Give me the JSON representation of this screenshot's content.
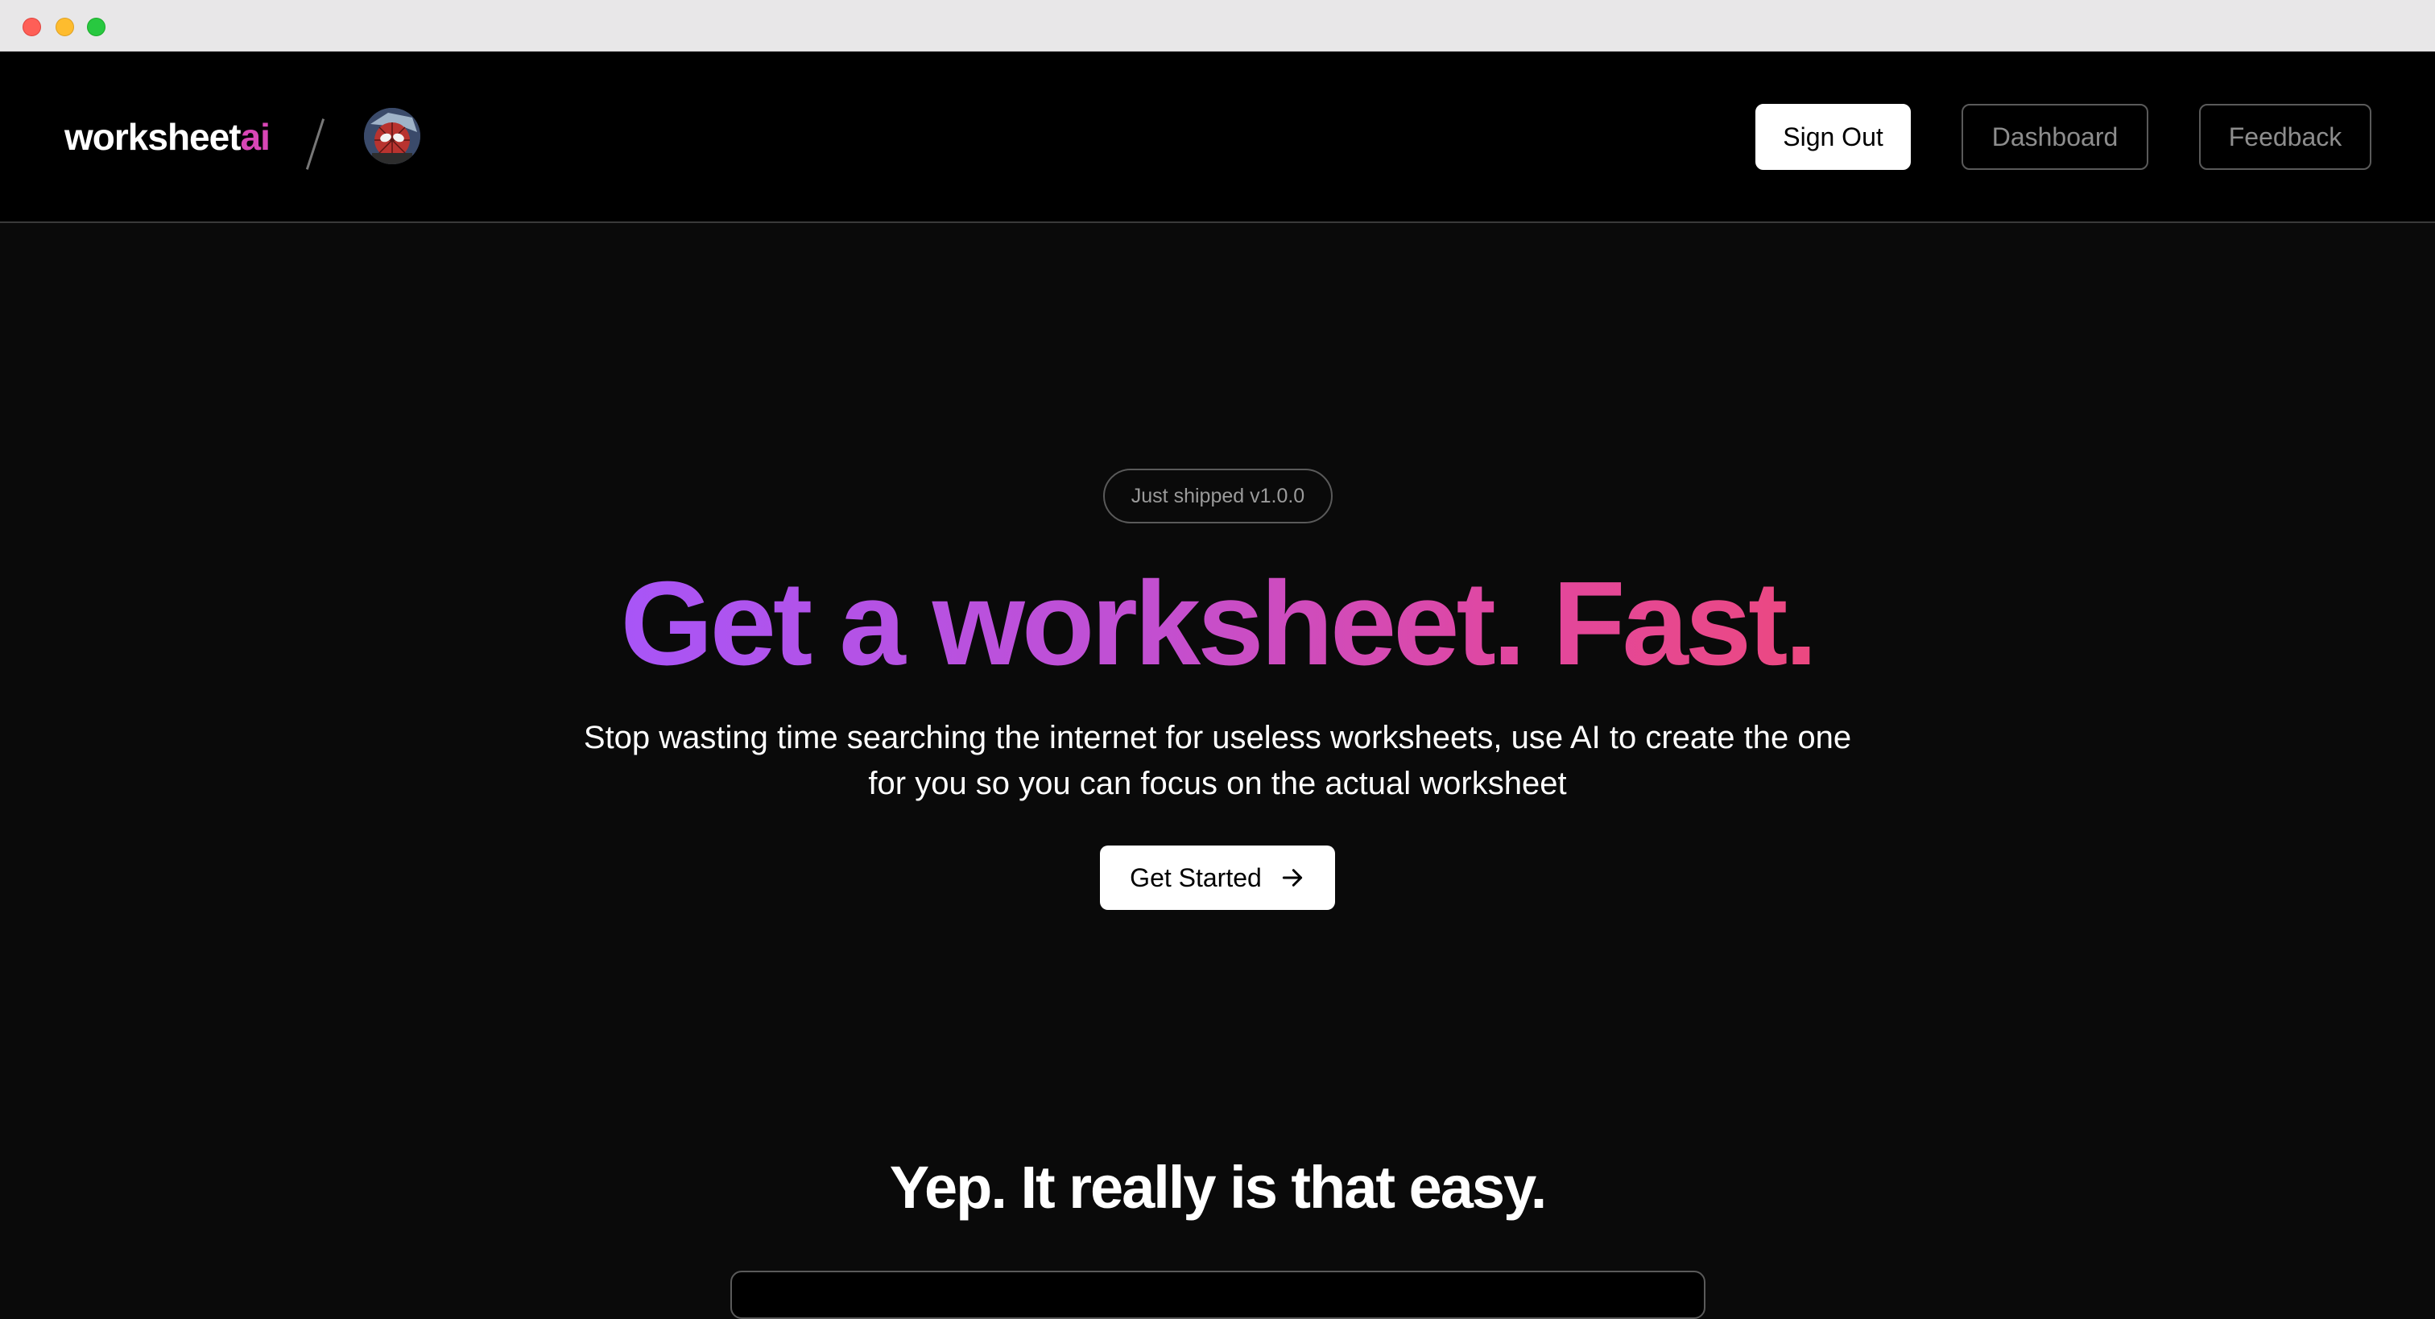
{
  "window": {
    "traffic_lights": [
      "close",
      "minimize",
      "zoom"
    ]
  },
  "header": {
    "logo": {
      "text": "worksheet",
      "accent": "ai",
      "accent_color": "#d946b6"
    },
    "separator": "/",
    "avatar_icon": "user-avatar-icon",
    "nav": {
      "sign_out": "Sign Out",
      "dashboard": "Dashboard",
      "feedback": "Feedback"
    }
  },
  "hero": {
    "badge": "Just shipped v1.0.0",
    "headline": "Get a worksheet. Fast.",
    "headline_gradient": [
      "#a855f7",
      "#ec4880"
    ],
    "subtext": "Stop wasting time searching the internet for useless worksheets, use AI to create the one for you so you can focus on the actual worksheet",
    "cta": {
      "label": "Get Started",
      "icon": "arrow-right-icon"
    }
  },
  "section": {
    "title": "Yep. It really is that easy."
  },
  "colors": {
    "background": "#0a0a0a",
    "header_background": "#000000",
    "border": "#5a5a5a"
  }
}
